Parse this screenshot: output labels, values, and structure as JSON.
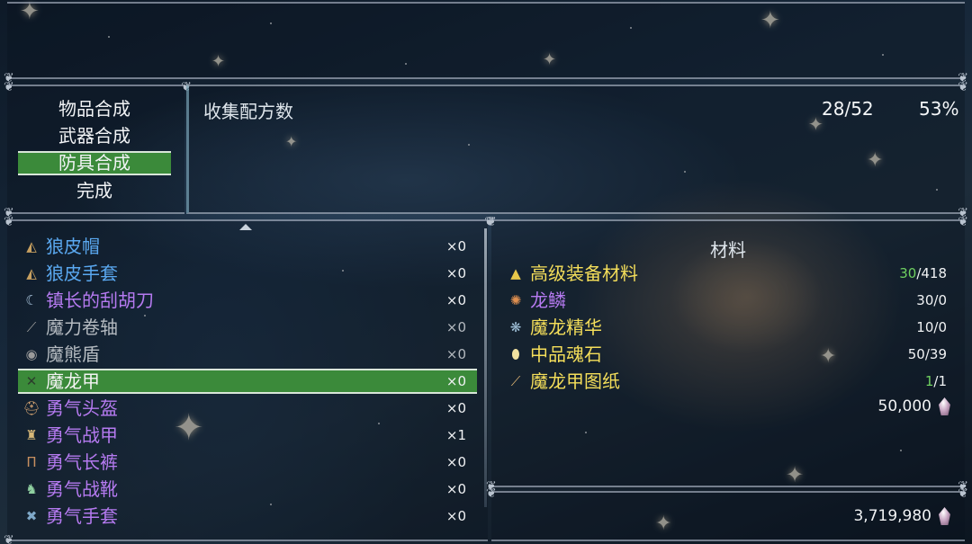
{
  "tabs": [
    {
      "label": "物品合成",
      "active": false
    },
    {
      "label": "武器合成",
      "active": false
    },
    {
      "label": "防具合成",
      "active": true
    },
    {
      "label": "完成",
      "active": false
    }
  ],
  "collection": {
    "label": "收集配方数",
    "count": "28/52",
    "percent": "53%"
  },
  "recipes": [
    {
      "name": "狼皮帽",
      "qty": "×0",
      "color": "#5aa8f0",
      "icon": "wolf-cap-icon"
    },
    {
      "name": "狼皮手套",
      "qty": "×0",
      "color": "#5aa8f0",
      "icon": "wolf-glove-icon"
    },
    {
      "name": "镇长的刮胡刀",
      "qty": "×0",
      "color": "#b57af0",
      "icon": "razor-icon"
    },
    {
      "name": "魔力卷轴",
      "qty": "×0",
      "color": "#b4bac0",
      "icon": "scroll-icon"
    },
    {
      "name": "魔熊盾",
      "qty": "×0",
      "color": "#b4bac0",
      "icon": "bear-shield-icon"
    },
    {
      "name": "魔龙甲",
      "qty": "×0",
      "color": "#f4f4f4",
      "icon": "dragon-armor-icon",
      "selected": true
    },
    {
      "name": "勇气头盔",
      "qty": "×0",
      "color": "#b57af0",
      "icon": "helmet-icon"
    },
    {
      "name": "勇气战甲",
      "qty": "×1",
      "color": "#b57af0",
      "icon": "armor-icon"
    },
    {
      "name": "勇气长裤",
      "qty": "×0",
      "color": "#b57af0",
      "icon": "pants-icon"
    },
    {
      "name": "勇气战靴",
      "qty": "×0",
      "color": "#b57af0",
      "icon": "boots-icon"
    },
    {
      "name": "勇气手套",
      "qty": "×0",
      "color": "#b57af0",
      "icon": "gloves-icon"
    }
  ],
  "materials": {
    "title": "材料",
    "items": [
      {
        "name": "高级装备材料",
        "have": "30",
        "need": "/418",
        "have_ok": true,
        "color": "#f4de5a",
        "icon": "material-pile-icon"
      },
      {
        "name": "龙鳞",
        "have": "30",
        "need": "/0",
        "have_ok": false,
        "color": "#b57af0",
        "icon": "dragon-scale-icon"
      },
      {
        "name": "魔龙精华",
        "have": "10",
        "need": "/0",
        "have_ok": false,
        "color": "#f4de5a",
        "icon": "essence-icon"
      },
      {
        "name": "中品魂石",
        "have": "50",
        "need": "/39",
        "have_ok": false,
        "color": "#f4de5a",
        "icon": "soul-stone-icon"
      },
      {
        "name": "魔龙甲图纸",
        "have": "1",
        "need": "/1",
        "have_ok": true,
        "color": "#f4de5a",
        "icon": "blueprint-icon"
      }
    ],
    "cost": "50,000",
    "cost_icon": "gem-currency-icon"
  },
  "wallet": {
    "money": "3,719,980",
    "money_icon": "gem-currency-icon"
  },
  "colors": {
    "active_green": "#3b8a3a",
    "rarity_blue": "#5aa8f0",
    "rarity_purple": "#b57af0",
    "rarity_gray": "#b4bac0",
    "rarity_yellow": "#f4de5a",
    "ok_green": "#6fd060"
  }
}
